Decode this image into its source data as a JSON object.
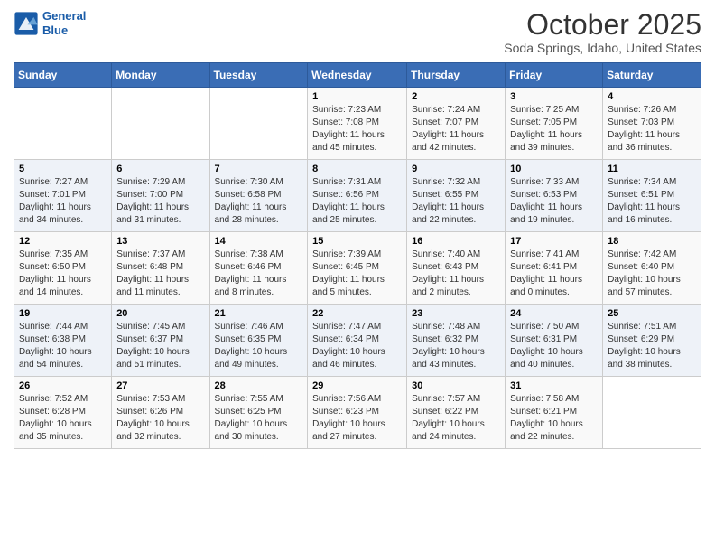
{
  "logo": {
    "line1": "General",
    "line2": "Blue"
  },
  "header": {
    "month": "October 2025",
    "location": "Soda Springs, Idaho, United States"
  },
  "weekdays": [
    "Sunday",
    "Monday",
    "Tuesday",
    "Wednesday",
    "Thursday",
    "Friday",
    "Saturday"
  ],
  "weeks": [
    [
      {
        "day": "",
        "sunrise": "",
        "sunset": "",
        "daylight": ""
      },
      {
        "day": "",
        "sunrise": "",
        "sunset": "",
        "daylight": ""
      },
      {
        "day": "",
        "sunrise": "",
        "sunset": "",
        "daylight": ""
      },
      {
        "day": "1",
        "sunrise": "Sunrise: 7:23 AM",
        "sunset": "Sunset: 7:08 PM",
        "daylight": "Daylight: 11 hours and 45 minutes."
      },
      {
        "day": "2",
        "sunrise": "Sunrise: 7:24 AM",
        "sunset": "Sunset: 7:07 PM",
        "daylight": "Daylight: 11 hours and 42 minutes."
      },
      {
        "day": "3",
        "sunrise": "Sunrise: 7:25 AM",
        "sunset": "Sunset: 7:05 PM",
        "daylight": "Daylight: 11 hours and 39 minutes."
      },
      {
        "day": "4",
        "sunrise": "Sunrise: 7:26 AM",
        "sunset": "Sunset: 7:03 PM",
        "daylight": "Daylight: 11 hours and 36 minutes."
      }
    ],
    [
      {
        "day": "5",
        "sunrise": "Sunrise: 7:27 AM",
        "sunset": "Sunset: 7:01 PM",
        "daylight": "Daylight: 11 hours and 34 minutes."
      },
      {
        "day": "6",
        "sunrise": "Sunrise: 7:29 AM",
        "sunset": "Sunset: 7:00 PM",
        "daylight": "Daylight: 11 hours and 31 minutes."
      },
      {
        "day": "7",
        "sunrise": "Sunrise: 7:30 AM",
        "sunset": "Sunset: 6:58 PM",
        "daylight": "Daylight: 11 hours and 28 minutes."
      },
      {
        "day": "8",
        "sunrise": "Sunrise: 7:31 AM",
        "sunset": "Sunset: 6:56 PM",
        "daylight": "Daylight: 11 hours and 25 minutes."
      },
      {
        "day": "9",
        "sunrise": "Sunrise: 7:32 AM",
        "sunset": "Sunset: 6:55 PM",
        "daylight": "Daylight: 11 hours and 22 minutes."
      },
      {
        "day": "10",
        "sunrise": "Sunrise: 7:33 AM",
        "sunset": "Sunset: 6:53 PM",
        "daylight": "Daylight: 11 hours and 19 minutes."
      },
      {
        "day": "11",
        "sunrise": "Sunrise: 7:34 AM",
        "sunset": "Sunset: 6:51 PM",
        "daylight": "Daylight: 11 hours and 16 minutes."
      }
    ],
    [
      {
        "day": "12",
        "sunrise": "Sunrise: 7:35 AM",
        "sunset": "Sunset: 6:50 PM",
        "daylight": "Daylight: 11 hours and 14 minutes."
      },
      {
        "day": "13",
        "sunrise": "Sunrise: 7:37 AM",
        "sunset": "Sunset: 6:48 PM",
        "daylight": "Daylight: 11 hours and 11 minutes."
      },
      {
        "day": "14",
        "sunrise": "Sunrise: 7:38 AM",
        "sunset": "Sunset: 6:46 PM",
        "daylight": "Daylight: 11 hours and 8 minutes."
      },
      {
        "day": "15",
        "sunrise": "Sunrise: 7:39 AM",
        "sunset": "Sunset: 6:45 PM",
        "daylight": "Daylight: 11 hours and 5 minutes."
      },
      {
        "day": "16",
        "sunrise": "Sunrise: 7:40 AM",
        "sunset": "Sunset: 6:43 PM",
        "daylight": "Daylight: 11 hours and 2 minutes."
      },
      {
        "day": "17",
        "sunrise": "Sunrise: 7:41 AM",
        "sunset": "Sunset: 6:41 PM",
        "daylight": "Daylight: 11 hours and 0 minutes."
      },
      {
        "day": "18",
        "sunrise": "Sunrise: 7:42 AM",
        "sunset": "Sunset: 6:40 PM",
        "daylight": "Daylight: 10 hours and 57 minutes."
      }
    ],
    [
      {
        "day": "19",
        "sunrise": "Sunrise: 7:44 AM",
        "sunset": "Sunset: 6:38 PM",
        "daylight": "Daylight: 10 hours and 54 minutes."
      },
      {
        "day": "20",
        "sunrise": "Sunrise: 7:45 AM",
        "sunset": "Sunset: 6:37 PM",
        "daylight": "Daylight: 10 hours and 51 minutes."
      },
      {
        "day": "21",
        "sunrise": "Sunrise: 7:46 AM",
        "sunset": "Sunset: 6:35 PM",
        "daylight": "Daylight: 10 hours and 49 minutes."
      },
      {
        "day": "22",
        "sunrise": "Sunrise: 7:47 AM",
        "sunset": "Sunset: 6:34 PM",
        "daylight": "Daylight: 10 hours and 46 minutes."
      },
      {
        "day": "23",
        "sunrise": "Sunrise: 7:48 AM",
        "sunset": "Sunset: 6:32 PM",
        "daylight": "Daylight: 10 hours and 43 minutes."
      },
      {
        "day": "24",
        "sunrise": "Sunrise: 7:50 AM",
        "sunset": "Sunset: 6:31 PM",
        "daylight": "Daylight: 10 hours and 40 minutes."
      },
      {
        "day": "25",
        "sunrise": "Sunrise: 7:51 AM",
        "sunset": "Sunset: 6:29 PM",
        "daylight": "Daylight: 10 hours and 38 minutes."
      }
    ],
    [
      {
        "day": "26",
        "sunrise": "Sunrise: 7:52 AM",
        "sunset": "Sunset: 6:28 PM",
        "daylight": "Daylight: 10 hours and 35 minutes."
      },
      {
        "day": "27",
        "sunrise": "Sunrise: 7:53 AM",
        "sunset": "Sunset: 6:26 PM",
        "daylight": "Daylight: 10 hours and 32 minutes."
      },
      {
        "day": "28",
        "sunrise": "Sunrise: 7:55 AM",
        "sunset": "Sunset: 6:25 PM",
        "daylight": "Daylight: 10 hours and 30 minutes."
      },
      {
        "day": "29",
        "sunrise": "Sunrise: 7:56 AM",
        "sunset": "Sunset: 6:23 PM",
        "daylight": "Daylight: 10 hours and 27 minutes."
      },
      {
        "day": "30",
        "sunrise": "Sunrise: 7:57 AM",
        "sunset": "Sunset: 6:22 PM",
        "daylight": "Daylight: 10 hours and 24 minutes."
      },
      {
        "day": "31",
        "sunrise": "Sunrise: 7:58 AM",
        "sunset": "Sunset: 6:21 PM",
        "daylight": "Daylight: 10 hours and 22 minutes."
      },
      {
        "day": "",
        "sunrise": "",
        "sunset": "",
        "daylight": ""
      }
    ]
  ]
}
